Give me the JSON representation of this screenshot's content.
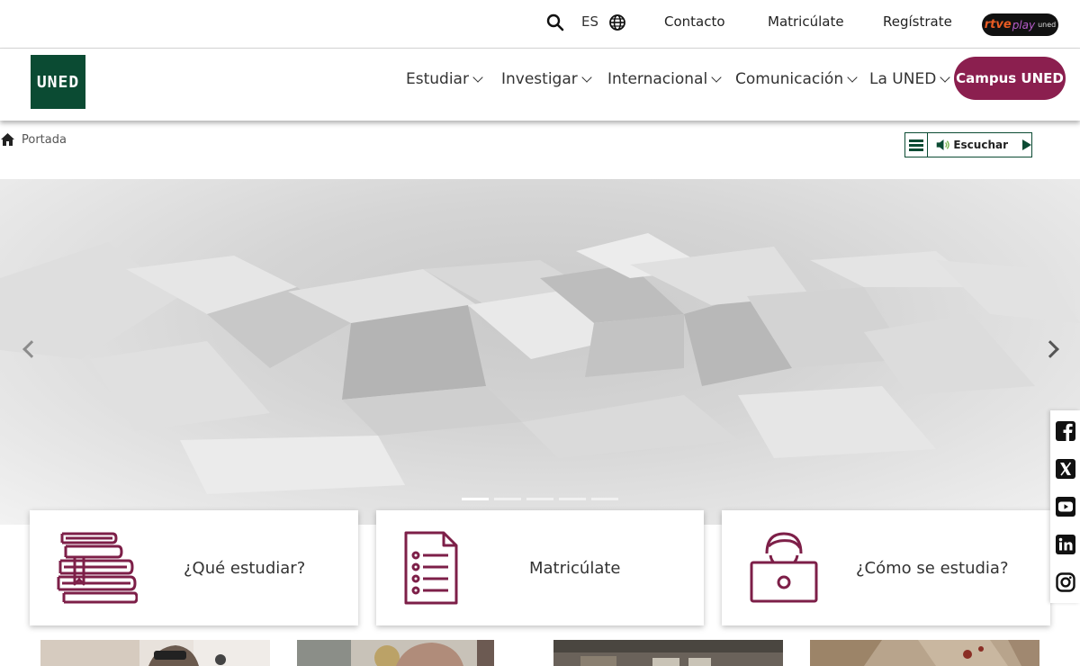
{
  "topbar": {
    "language": "ES",
    "links": [
      "Contacto",
      "Matricúlate",
      "Regístrate"
    ],
    "rtve": {
      "brand": "rtve",
      "play": "play",
      "sub": "uned"
    }
  },
  "logo": {
    "text": "UNED"
  },
  "nav": {
    "items": [
      "Estudiar",
      "Investigar",
      "Internacional",
      "Comunicación",
      "La UNED"
    ],
    "campus_button": "Campus UNED"
  },
  "breadcrumb": {
    "home_label": "Portada"
  },
  "listen": {
    "label": "Escuchar"
  },
  "hero": {
    "slide_count": 5,
    "active_slide": 1
  },
  "cards": [
    {
      "label": "¿Qué estudiar?",
      "icon": "books-icon"
    },
    {
      "label": "Matricúlate",
      "icon": "document-list-icon"
    },
    {
      "label": "¿Cómo se estudia?",
      "icon": "student-laptop-icon"
    }
  ],
  "social": [
    "facebook-icon",
    "x-icon",
    "youtube-icon",
    "linkedin-icon",
    "instagram-icon"
  ],
  "colors": {
    "brand_green": "#0b4b33",
    "accent_maroon": "#8b1f4f",
    "icon_maroon": "#7d1f48"
  }
}
